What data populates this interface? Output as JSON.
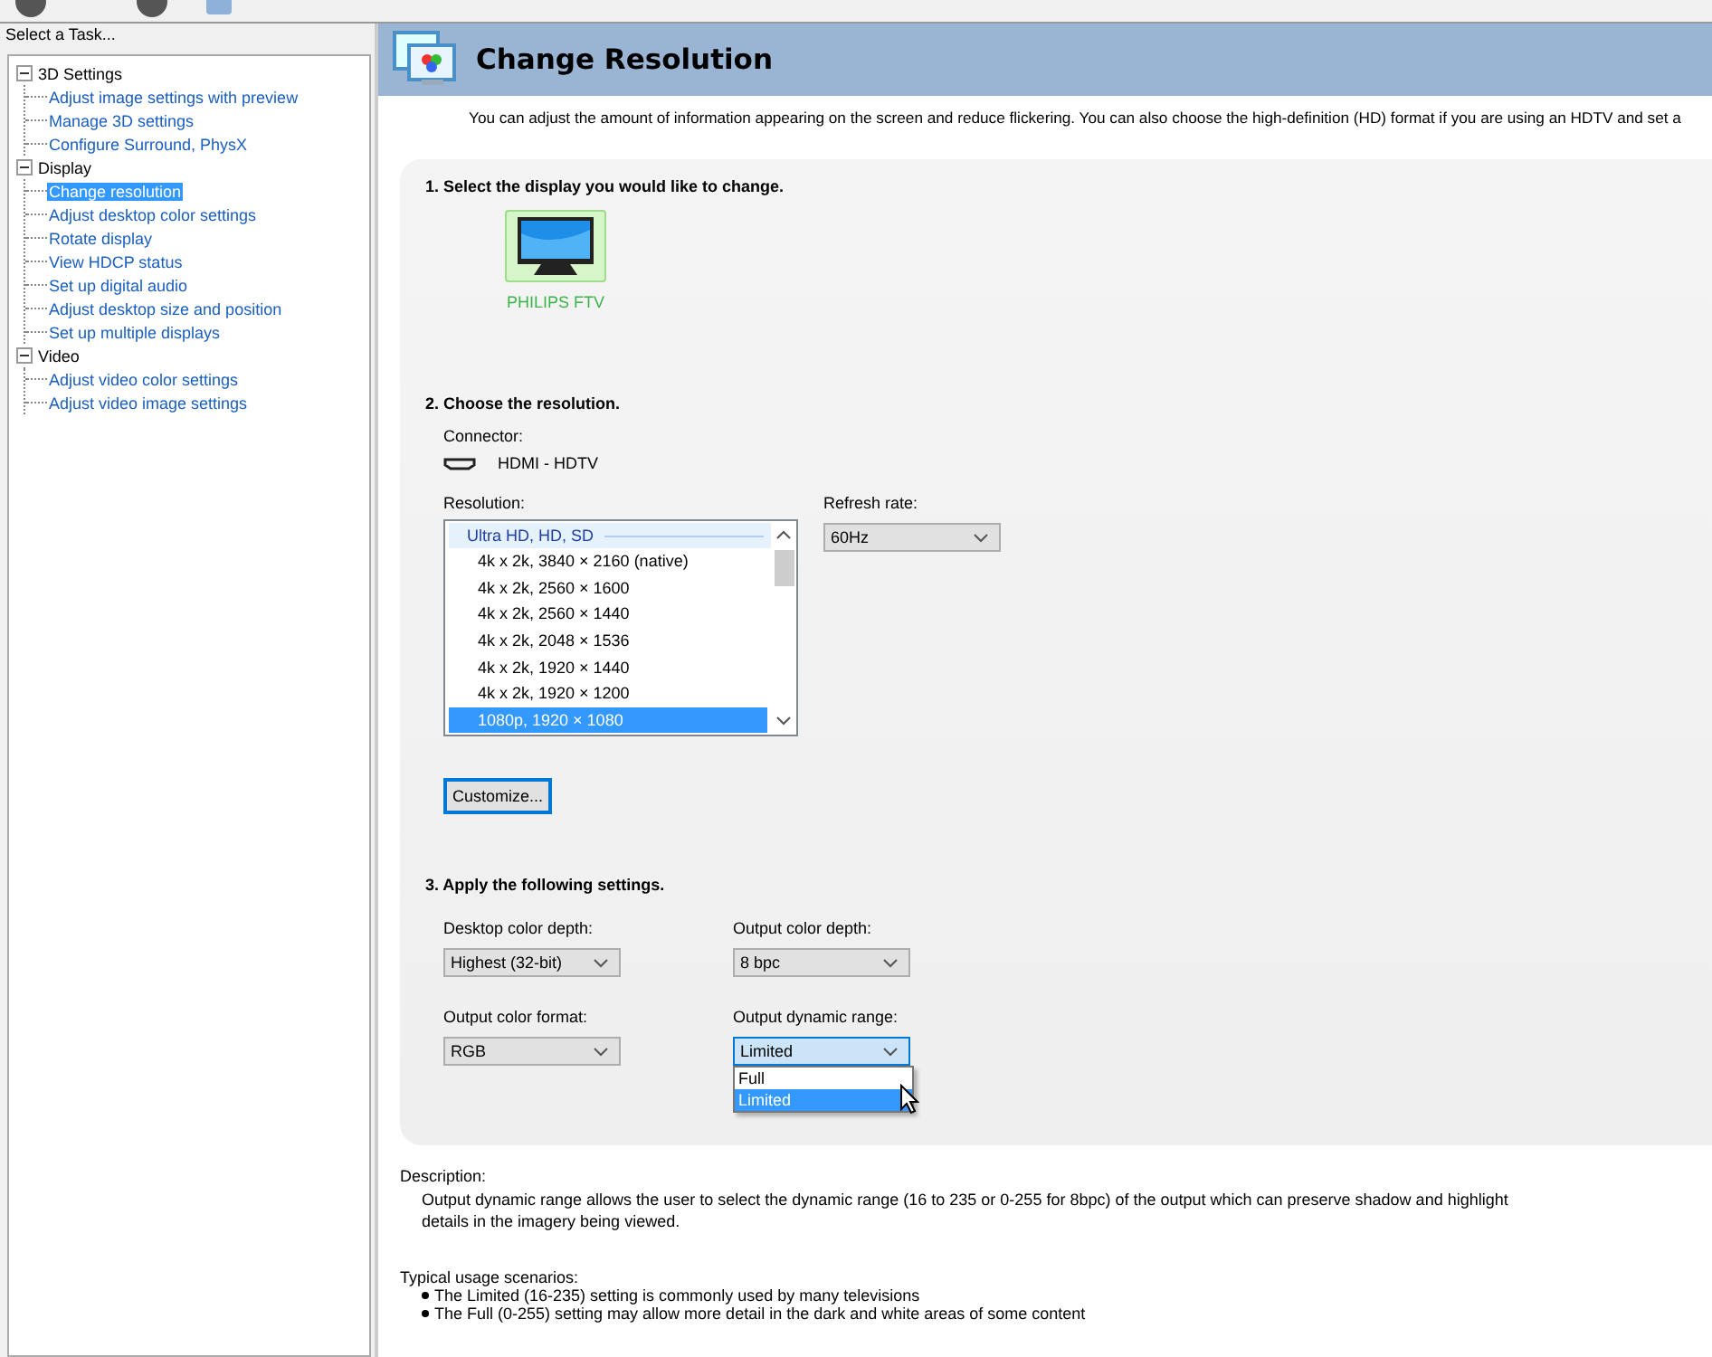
{
  "task_pane": {
    "title": "Select a Task...",
    "tree": [
      {
        "label": "3D Settings",
        "expanded": true,
        "selected": false,
        "children": [
          {
            "label": "Adjust image settings with preview",
            "selected": false
          },
          {
            "label": "Manage 3D settings",
            "selected": false
          },
          {
            "label": "Configure Surround, PhysX",
            "selected": false
          }
        ]
      },
      {
        "label": "Display",
        "expanded": true,
        "selected": false,
        "children": [
          {
            "label": "Change resolution",
            "selected": true
          },
          {
            "label": "Adjust desktop color settings",
            "selected": false
          },
          {
            "label": "Rotate display",
            "selected": false
          },
          {
            "label": "View HDCP status",
            "selected": false
          },
          {
            "label": "Set up digital audio",
            "selected": false
          },
          {
            "label": "Adjust desktop size and position",
            "selected": false
          },
          {
            "label": "Set up multiple displays",
            "selected": false
          }
        ]
      },
      {
        "label": "Video",
        "expanded": true,
        "selected": false,
        "children": [
          {
            "label": "Adjust video color settings",
            "selected": false
          },
          {
            "label": "Adjust video image settings",
            "selected": false
          }
        ]
      }
    ]
  },
  "page": {
    "title": "Change Resolution",
    "intro": "You can adjust the amount of information appearing on the screen and reduce flickering. You can also choose the high-definition (HD) format if you are using an HDTV and set a",
    "section_1": {
      "heading": "1. Select the display you would like to change.",
      "displays": [
        {
          "label": "PHILIPS FTV",
          "selected": true
        }
      ]
    },
    "section_2": {
      "heading": "2. Choose the resolution.",
      "connector_label": "Connector:",
      "connector": "HDMI - HDTV",
      "resolution_label": "Resolution:",
      "resolution_list": [
        {
          "kind": "group",
          "label": "Ultra HD, HD, SD"
        },
        {
          "kind": "item",
          "label": "4k x 2k, 3840 × 2160 (native)",
          "selected": false
        },
        {
          "kind": "item",
          "label": "4k x 2k, 2560 × 1600",
          "selected": false
        },
        {
          "kind": "item",
          "label": "4k x 2k, 2560 × 1440",
          "selected": false
        },
        {
          "kind": "item",
          "label": "4k x 2k, 2048 × 1536",
          "selected": false
        },
        {
          "kind": "item",
          "label": "4k x 2k, 1920 × 1440",
          "selected": false
        },
        {
          "kind": "item",
          "label": "4k x 2k, 1920 × 1200",
          "selected": false
        },
        {
          "kind": "item",
          "label": "1080p, 1920 × 1080",
          "selected": true
        }
      ],
      "refresh_label": "Refresh rate:",
      "refresh_rate": "60Hz",
      "customize_button": "Customize..."
    },
    "section_3": {
      "heading": "3. Apply the following settings.",
      "settings": [
        {
          "label": "Desktop color depth:",
          "value": "Highest (32-bit)",
          "expanded": false
        },
        {
          "label": "Output color depth:",
          "value": "8 bpc",
          "expanded": false
        },
        {
          "label": "Output color format:",
          "value": "RGB",
          "expanded": false
        },
        {
          "label": "Output dynamic range:",
          "value": "Limited",
          "expanded": true,
          "options": [
            {
              "label": "Full",
              "selected": false
            },
            {
              "label": "Limited",
              "selected": true
            }
          ]
        }
      ]
    },
    "description_label": "Description:",
    "description": "Output dynamic range allows the user to select the dynamic range (16 to 235 or 0-255 for 8bpc) of the output which can preserve shadow and highlight details in the imagery being viewed.",
    "scenarios_label": "Typical usage scenarios:",
    "scenarios": [
      "The Limited (16-235) setting is commonly used by many televisions",
      "The Full (0-255) setting may allow more detail in the dark and white areas of some content"
    ]
  }
}
